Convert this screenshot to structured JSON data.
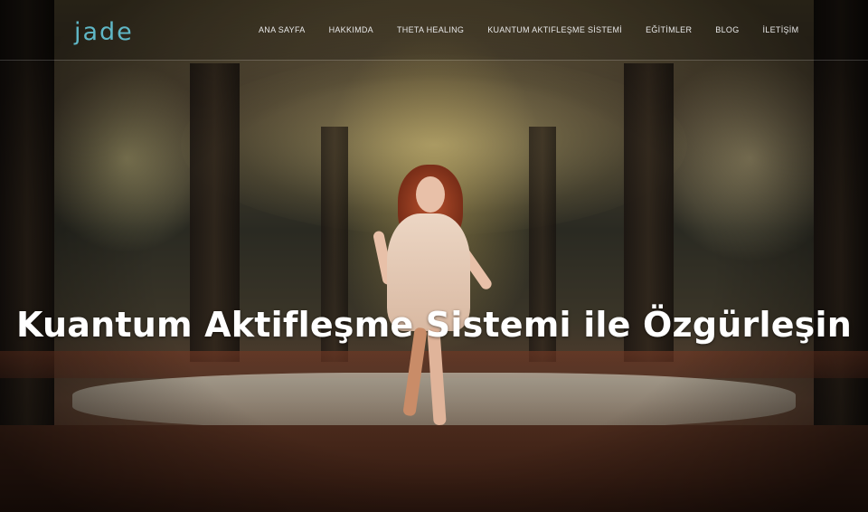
{
  "header": {
    "logo_text": "jade",
    "logo_sub": "",
    "nav": [
      {
        "label": "ANA SAYFA"
      },
      {
        "label": "HAKKIMDA"
      },
      {
        "label": "THETA HEALING"
      },
      {
        "label": "KUANTUM AKTIFLEŞME SİSTEMİ"
      },
      {
        "label": "EĞİTİMLER"
      },
      {
        "label": "BLOG"
      },
      {
        "label": "İLETİŞİM"
      }
    ]
  },
  "hero": {
    "title": "Kuantum Aktifleşme Sistemi ile Özgürleşin",
    "image": "forest-running-girl"
  },
  "colors": {
    "brand": "#5fb7c6",
    "nav_text": "#e8e8e8",
    "title_text": "#ffffff"
  }
}
